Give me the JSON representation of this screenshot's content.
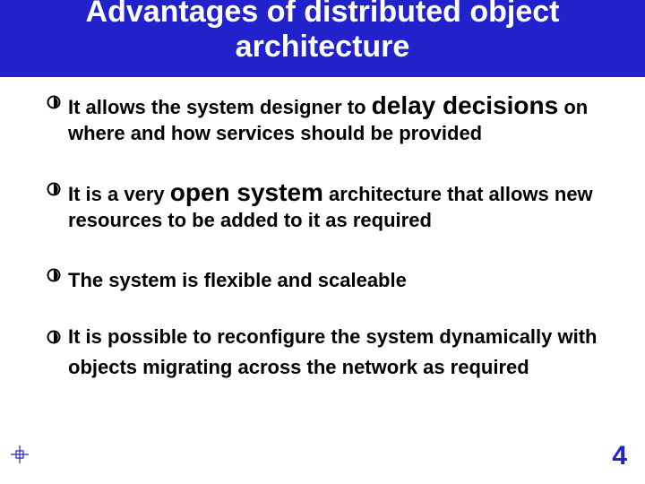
{
  "title": "Advantages of distributed object architecture",
  "bullets": [
    {
      "pre": "It allows the system designer to ",
      "big": "delay decisions",
      "post": " on where and how services should be provided"
    },
    {
      "pre": "It is a very ",
      "big": "open system",
      "post": " architecture that allows new resources to be added to it as required"
    },
    {
      "pre": "The system is flexible and scaleable",
      "big": "",
      "post": ""
    },
    {
      "pre": "It is possible to reconfigure the system dynamically with objects migrating across the network as required",
      "big": "",
      "post": ""
    }
  ],
  "page_number": "4"
}
